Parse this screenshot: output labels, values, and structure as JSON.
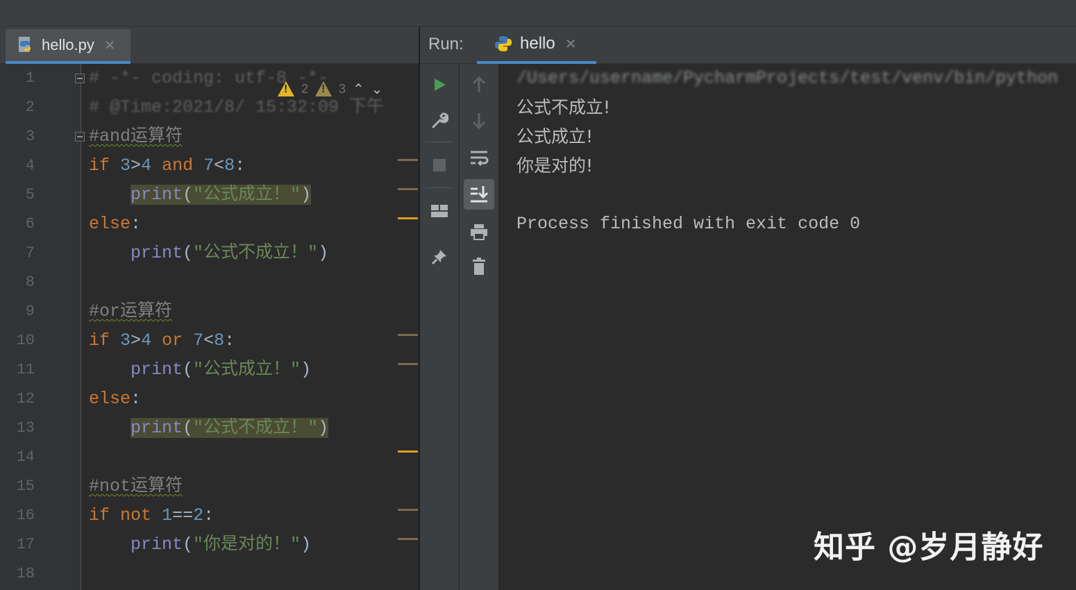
{
  "editor": {
    "tab": {
      "label": "hello.py"
    },
    "line_numbers": [
      "1",
      "2",
      "3",
      "4",
      "5",
      "6",
      "7",
      "8",
      "9",
      "10",
      "11",
      "12",
      "13",
      "14",
      "15",
      "16",
      "17",
      "18"
    ],
    "lines": {
      "l1_blurred": "# -*- coding: utf-8 -*-",
      "l1_warning_count": "2",
      "l1_weak_count": "3",
      "l2_blurred": "# @Time:2021/8/ 15:32:09 下午",
      "l3_comment": "#and运算符",
      "l4": {
        "if": "if",
        "n1": "3",
        "op1": ">",
        "n2": "4",
        "and": "and",
        "n3": "7",
        "op2": "<",
        "n4": "8",
        "colon": ":"
      },
      "l5": {
        "print": "print",
        "open": "(",
        "str": "\"公式成立！\"",
        "close": ")"
      },
      "l6": {
        "else": "else",
        "colon": ":"
      },
      "l7": {
        "print": "print",
        "open": "(",
        "str": "\"公式不成立！\"",
        "close": ")"
      },
      "l9_comment": "#or运算符",
      "l10": {
        "if": "if",
        "n1": "3",
        "op1": ">",
        "n2": "4",
        "or": "or",
        "n3": "7",
        "op2": "<",
        "n4": "8",
        "colon": ":"
      },
      "l11": {
        "print": "print",
        "open": "(",
        "str": "\"公式成立！\"",
        "close": ")"
      },
      "l12": {
        "else": "else",
        "colon": ":"
      },
      "l13": {
        "print": "print",
        "open": "(",
        "str": "\"公式不成立！\"",
        "close": ")"
      },
      "l15_comment": "#not运算符",
      "l16": {
        "if": "if",
        "not": "not",
        "n1": "1",
        "op": "==",
        "n2": "2",
        "colon": ":"
      },
      "l17": {
        "print": "print",
        "open": "(",
        "str": "\"你是对的！\"",
        "close": ")"
      }
    }
  },
  "run": {
    "title": "Run:",
    "tab": {
      "label": "hello"
    },
    "output": {
      "command_blurred": "/Users/username/PycharmProjects/test/venv/bin/python",
      "line1": "公式不成立!",
      "line2": "公式成立!",
      "line3": "你是对的!",
      "exit": "Process finished with exit code 0"
    }
  },
  "colors": {
    "keyword": "#cc7832",
    "number": "#6897bb",
    "builtin": "#8888c6",
    "string": "#6a8759",
    "comment": "#808080",
    "run_green": "#499c54",
    "warning": "#e2b428"
  },
  "watermark": "知乎 @岁月静好"
}
